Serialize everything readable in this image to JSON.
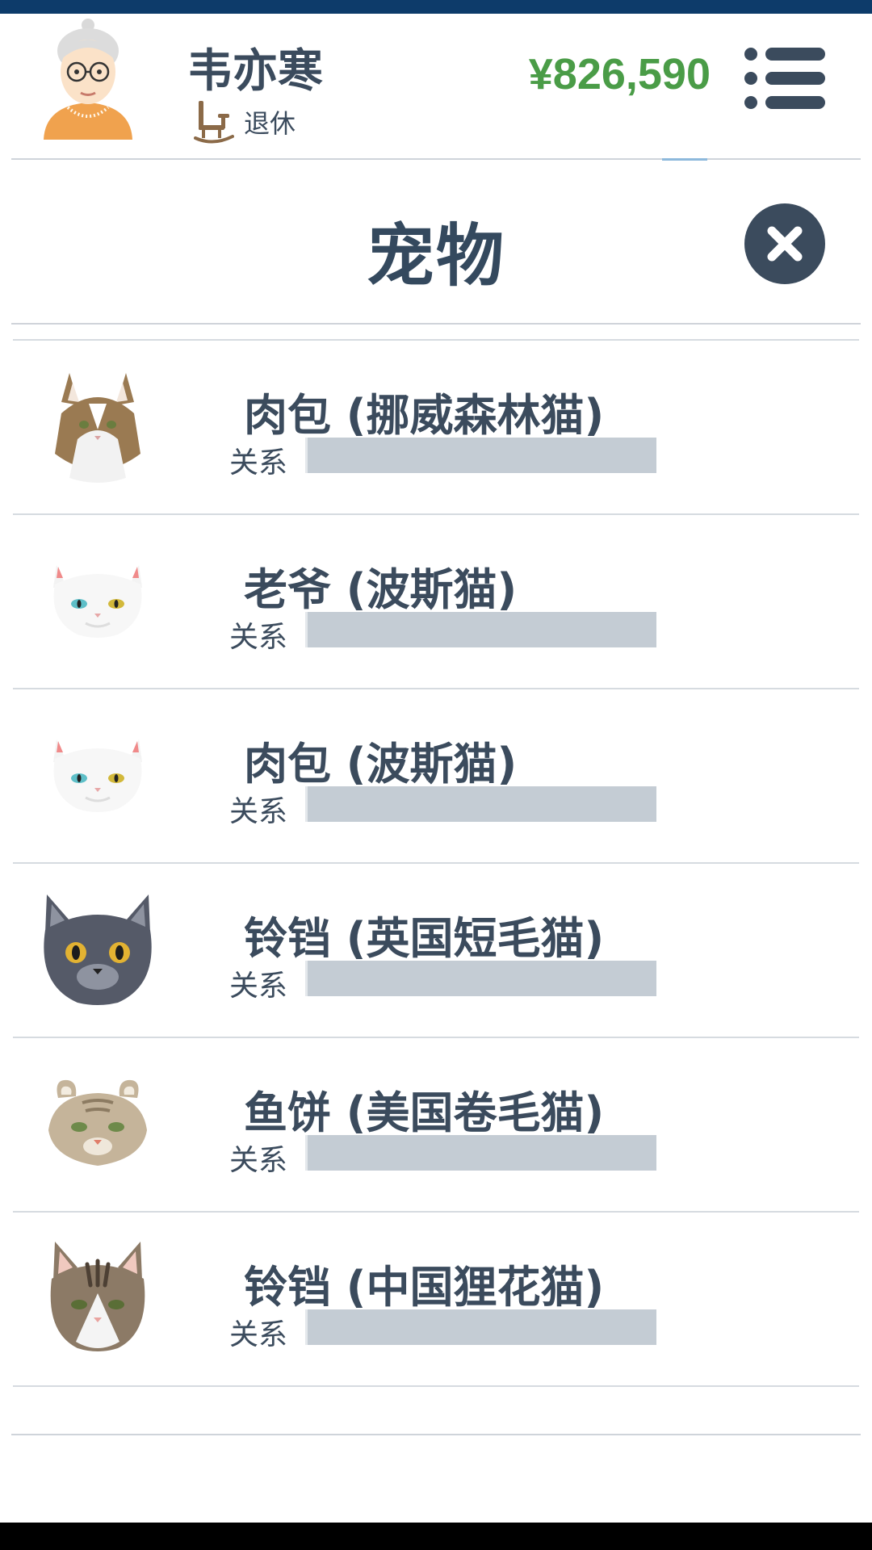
{
  "player": {
    "name": "韦亦寒",
    "status": "退休",
    "money": "¥826,590"
  },
  "modal": {
    "title": "宠物"
  },
  "pets": [
    {
      "name": "肉包 (挪威森林猫)",
      "relation_label": "关系",
      "relation_level": 0,
      "icon": "norwegian-forest-cat-icon"
    },
    {
      "name": "老爷 (波斯猫)",
      "relation_label": "关系",
      "relation_level": 0,
      "icon": "persian-cat-icon"
    },
    {
      "name": "肉包 (波斯猫)",
      "relation_label": "关系",
      "relation_level": 0,
      "icon": "persian-cat-icon"
    },
    {
      "name": "铃铛 (英国短毛猫)",
      "relation_label": "关系",
      "relation_level": 0,
      "icon": "british-shorthair-icon"
    },
    {
      "name": "鱼饼 (美国卷毛猫)",
      "relation_label": "关系",
      "relation_level": 0,
      "icon": "american-curl-icon"
    },
    {
      "name": "铃铛 (中国狸花猫)",
      "relation_label": "关系",
      "relation_level": 0,
      "icon": "chinese-li-hua-icon"
    }
  ],
  "colors": {
    "accent": "#3b4b5d",
    "money": "#4a9c47",
    "relation_track": "#c4ccd4",
    "status_bar": "#0d3b6a"
  }
}
